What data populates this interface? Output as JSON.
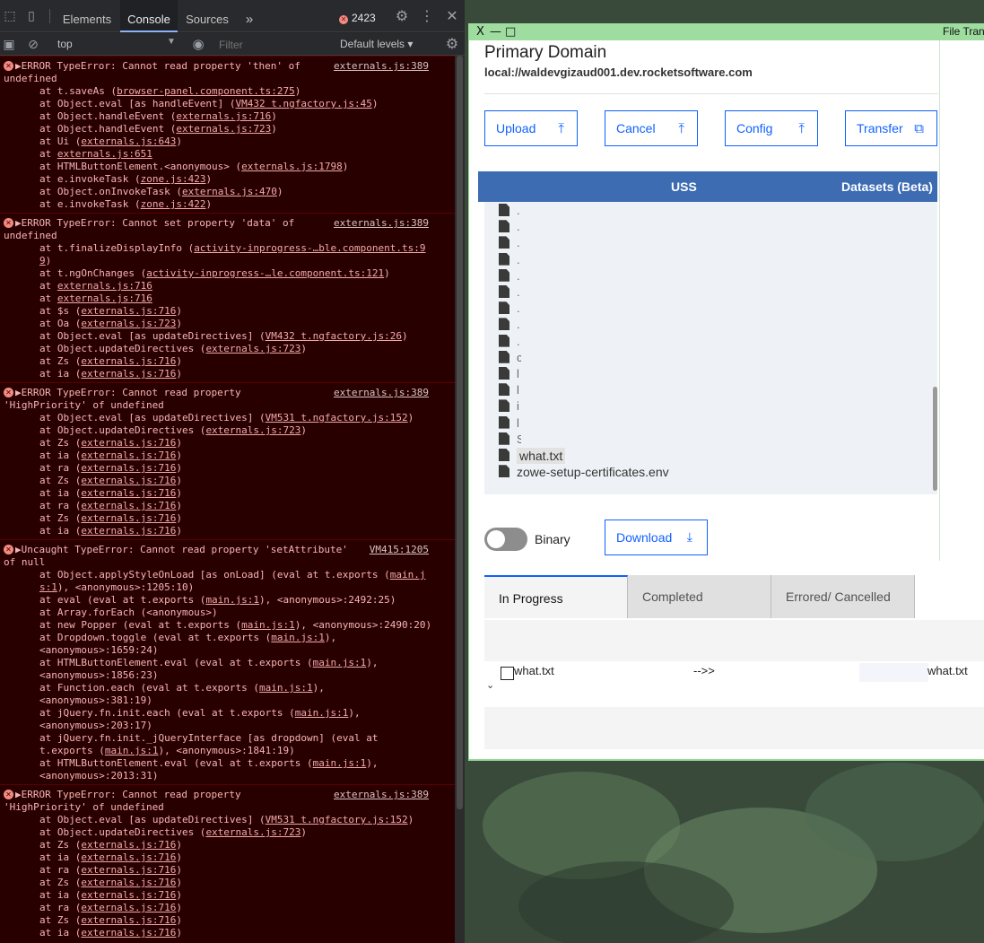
{
  "devtools": {
    "tabs": [
      "Elements",
      "Console",
      "Sources"
    ],
    "more_tabs": "»",
    "error_count": "2423",
    "context": "top",
    "filter_placeholder": "Filter",
    "levels": "Default levels ▾",
    "messages": [
      {
        "head": "▶ERROR TypeError: Cannot read property 'then' of",
        "src": "externals.js:389",
        "cont": "undefined",
        "trace": [
          [
            [
              "at t.saveAs (",
              0
            ],
            [
              "browser-panel.component.ts:275",
              1
            ],
            [
              ")",
              0
            ]
          ],
          [
            [
              "at Object.eval [as handleEvent] (",
              0
            ],
            [
              "VM432 t.ngfactory.js:45",
              1
            ],
            [
              ")",
              0
            ]
          ],
          [
            [
              "at Object.handleEvent (",
              0
            ],
            [
              "externals.js:716",
              1
            ],
            [
              ")",
              0
            ]
          ],
          [
            [
              "at Object.handleEvent (",
              0
            ],
            [
              "externals.js:723",
              1
            ],
            [
              ")",
              0
            ]
          ],
          [
            [
              "at Ui (",
              0
            ],
            [
              "externals.js:643",
              1
            ],
            [
              ")",
              0
            ]
          ],
          [
            [
              "at ",
              0
            ],
            [
              "externals.js:651",
              1
            ]
          ],
          [
            [
              "at HTMLButtonElement.<anonymous> (",
              0
            ],
            [
              "externals.js:1798",
              1
            ],
            [
              ")",
              0
            ]
          ],
          [
            [
              "at e.invokeTask (",
              0
            ],
            [
              "zone.js:423",
              1
            ],
            [
              ")",
              0
            ]
          ],
          [
            [
              "at Object.onInvokeTask (",
              0
            ],
            [
              "externals.js:470",
              1
            ],
            [
              ")",
              0
            ]
          ],
          [
            [
              "at e.invokeTask (",
              0
            ],
            [
              "zone.js:422",
              1
            ],
            [
              ")",
              0
            ]
          ]
        ]
      },
      {
        "head": "▶ERROR TypeError: Cannot set property 'data' of",
        "src": "externals.js:389",
        "cont": "undefined",
        "trace": [
          [
            [
              "at t.finalizeDisplayInfo (",
              0
            ],
            [
              "activity-inprogress-…ble.component.ts:9",
              1
            ]
          ],
          [
            [
              "9",
              1
            ],
            [
              ")",
              0
            ]
          ],
          [
            [
              "at t.ngOnChanges (",
              0
            ],
            [
              "activity-inprogress-…le.component.ts:121",
              1
            ],
            [
              ")",
              0
            ]
          ],
          [
            [
              "at ",
              0
            ],
            [
              "externals.js:716",
              1
            ]
          ],
          [
            [
              "at ",
              0
            ],
            [
              "externals.js:716",
              1
            ]
          ],
          [
            [
              "at $s (",
              0
            ],
            [
              "externals.js:716",
              1
            ],
            [
              ")",
              0
            ]
          ],
          [
            [
              "at Oa (",
              0
            ],
            [
              "externals.js:723",
              1
            ],
            [
              ")",
              0
            ]
          ],
          [
            [
              "at Object.eval [as updateDirectives] (",
              0
            ],
            [
              "VM432 t.ngfactory.js:26",
              1
            ],
            [
              ")",
              0
            ]
          ],
          [
            [
              "at Object.updateDirectives (",
              0
            ],
            [
              "externals.js:723",
              1
            ],
            [
              ")",
              0
            ]
          ],
          [
            [
              "at Zs (",
              0
            ],
            [
              "externals.js:716",
              1
            ],
            [
              ")",
              0
            ]
          ],
          [
            [
              "at ia (",
              0
            ],
            [
              "externals.js:716",
              1
            ],
            [
              ")",
              0
            ]
          ]
        ]
      },
      {
        "head": "▶ERROR TypeError: Cannot read property",
        "src": "externals.js:389",
        "cont": "'HighPriority' of undefined",
        "trace": [
          [
            [
              "at Object.eval [as updateDirectives] (",
              0
            ],
            [
              "VM531 t.ngfactory.js:152",
              1
            ],
            [
              ")",
              0
            ]
          ],
          [
            [
              "at Object.updateDirectives (",
              0
            ],
            [
              "externals.js:723",
              1
            ],
            [
              ")",
              0
            ]
          ],
          [
            [
              "at Zs (",
              0
            ],
            [
              "externals.js:716",
              1
            ],
            [
              ")",
              0
            ]
          ],
          [
            [
              "at ia (",
              0
            ],
            [
              "externals.js:716",
              1
            ],
            [
              ")",
              0
            ]
          ],
          [
            [
              "at ra (",
              0
            ],
            [
              "externals.js:716",
              1
            ],
            [
              ")",
              0
            ]
          ],
          [
            [
              "at Zs (",
              0
            ],
            [
              "externals.js:716",
              1
            ],
            [
              ")",
              0
            ]
          ],
          [
            [
              "at ia (",
              0
            ],
            [
              "externals.js:716",
              1
            ],
            [
              ")",
              0
            ]
          ],
          [
            [
              "at ra (",
              0
            ],
            [
              "externals.js:716",
              1
            ],
            [
              ")",
              0
            ]
          ],
          [
            [
              "at Zs (",
              0
            ],
            [
              "externals.js:716",
              1
            ],
            [
              ")",
              0
            ]
          ],
          [
            [
              "at ia (",
              0
            ],
            [
              "externals.js:716",
              1
            ],
            [
              ")",
              0
            ]
          ]
        ]
      },
      {
        "head": "▶Uncaught TypeError: Cannot read property 'setAttribute'",
        "src": "VM415:1205",
        "cont": "of null",
        "trace": [
          [
            [
              "at Object.applyStyleOnLoad [as onLoad] (eval at t.exports (",
              0
            ],
            [
              "main.j",
              1
            ]
          ],
          [
            [
              "s:1",
              1
            ],
            [
              "), <anonymous>:1205:10)",
              0
            ]
          ],
          [
            [
              "at eval (eval at t.exports (",
              0
            ],
            [
              "main.js:1",
              1
            ],
            [
              "), <anonymous>:2492:25)",
              0
            ]
          ],
          [
            [
              "at Array.forEach (<anonymous>)",
              0
            ]
          ],
          [
            [
              "at new Popper (eval at t.exports (",
              0
            ],
            [
              "main.js:1",
              1
            ],
            [
              "), <anonymous>:2490:20)",
              0
            ]
          ],
          [
            [
              "at Dropdown.toggle (eval at t.exports (",
              0
            ],
            [
              "main.js:1",
              1
            ],
            [
              "),",
              0
            ]
          ],
          [
            [
              "<anonymous>:1659:24)",
              0
            ]
          ],
          [
            [
              "at HTMLButtonElement.eval (eval at t.exports (",
              0
            ],
            [
              "main.js:1",
              1
            ],
            [
              "),",
              0
            ]
          ],
          [
            [
              "<anonymous>:1856:23)",
              0
            ]
          ],
          [
            [
              "at Function.each (eval at t.exports (",
              0
            ],
            [
              "main.js:1",
              1
            ],
            [
              "),",
              0
            ]
          ],
          [
            [
              "<anonymous>:381:19)",
              0
            ]
          ],
          [
            [
              "at jQuery.fn.init.each (eval at t.exports (",
              0
            ],
            [
              "main.js:1",
              1
            ],
            [
              "),",
              0
            ]
          ],
          [
            [
              "<anonymous>:203:17)",
              0
            ]
          ],
          [
            [
              "at jQuery.fn.init._jQueryInterface [as dropdown] (eval at",
              0
            ]
          ],
          [
            [
              "t.exports (",
              0
            ],
            [
              "main.js:1",
              1
            ],
            [
              "), <anonymous>:1841:19)",
              0
            ]
          ],
          [
            [
              "at HTMLButtonElement.eval (eval at t.exports (",
              0
            ],
            [
              "main.js:1",
              1
            ],
            [
              "),",
              0
            ]
          ],
          [
            [
              "<anonymous>:2013:31)",
              0
            ]
          ]
        ]
      },
      {
        "head": "▶ERROR TypeError: Cannot read property",
        "src": "externals.js:389",
        "cont": "'HighPriority' of undefined",
        "trace": [
          [
            [
              "at Object.eval [as updateDirectives] (",
              0
            ],
            [
              "VM531 t.ngfactory.js:152",
              1
            ],
            [
              ")",
              0
            ]
          ],
          [
            [
              "at Object.updateDirectives (",
              0
            ],
            [
              "externals.js:723",
              1
            ],
            [
              ")",
              0
            ]
          ],
          [
            [
              "at Zs (",
              0
            ],
            [
              "externals.js:716",
              1
            ],
            [
              ")",
              0
            ]
          ],
          [
            [
              "at ia (",
              0
            ],
            [
              "externals.js:716",
              1
            ],
            [
              ")",
              0
            ]
          ],
          [
            [
              "at ra (",
              0
            ],
            [
              "externals.js:716",
              1
            ],
            [
              ")",
              0
            ]
          ],
          [
            [
              "at Zs (",
              0
            ],
            [
              "externals.js:716",
              1
            ],
            [
              ")",
              0
            ]
          ],
          [
            [
              "at ia (",
              0
            ],
            [
              "externals.js:716",
              1
            ],
            [
              ")",
              0
            ]
          ],
          [
            [
              "at ra (",
              0
            ],
            [
              "externals.js:716",
              1
            ],
            [
              ")",
              0
            ]
          ],
          [
            [
              "at Zs (",
              0
            ],
            [
              "externals.js:716",
              1
            ],
            [
              ")",
              0
            ]
          ],
          [
            [
              "at ia (",
              0
            ],
            [
              "externals.js:716",
              1
            ],
            [
              ")",
              0
            ]
          ]
        ]
      }
    ]
  },
  "app": {
    "window_title": "File Tran",
    "window_controls": {
      "close": "X",
      "minimize": "—",
      "maximize": "□"
    },
    "domain_title": "Primary Domain",
    "domain_url": "local://waldevgizaud001.dev.rocketsoftware.com",
    "buttons": {
      "upload": "Upload",
      "cancel": "Cancel",
      "config": "Config",
      "transfer": "Transfer"
    },
    "fs_tabs": {
      "uss": "USS",
      "datasets": "Datasets (Beta)"
    },
    "tree_truncated": [
      ".",
      ".",
      ".",
      ".",
      ".",
      ".",
      ".",
      ".",
      ".",
      "c",
      "l",
      "l",
      "i",
      "l",
      "S"
    ],
    "tree_files": [
      "what.txt",
      "zowe-setup-certificates.env"
    ],
    "binary_label": "Binary",
    "download_label": "Download",
    "progress_tabs": [
      "In Progress",
      "Completed",
      "Errored/ Cancelled"
    ],
    "transfer_row": {
      "source": "what.txt",
      "arrow": "-->>",
      "destination": "what.txt"
    },
    "colors": {
      "accent": "#0f62fe",
      "tab_bar": "#3d6cb3",
      "titlebar": "#9fdc9f",
      "console_error_bg": "#290000"
    }
  }
}
